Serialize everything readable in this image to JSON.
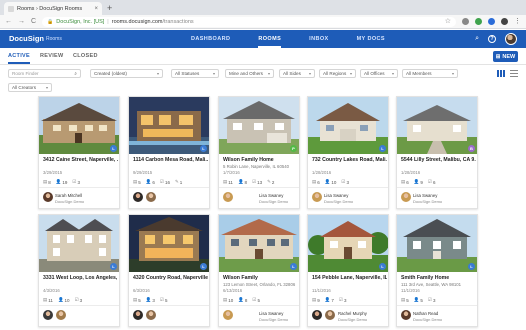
{
  "browser": {
    "tab_title": "Rooms › DocuSign Rooms",
    "tab_close": "×",
    "newtab": "+",
    "back": "←",
    "forward": "→",
    "reload": "C",
    "lock": "🔒",
    "cert": "DocuSign, Inc. [US]",
    "separator": "|",
    "url_host": "rooms.docusign.com",
    "url_path": "/transactions",
    "star": "☆",
    "dots": "⋮"
  },
  "app": {
    "logo": "DocuSign",
    "section": "Rooms",
    "nav": [
      "DASHBOARD",
      "ROOMS",
      "INBOX",
      "MY DOCS"
    ],
    "search_icon": "⌕",
    "help": "?",
    "accent": "#1e5cb8"
  },
  "subtabs": [
    "ACTIVE",
    "REVIEW",
    "CLOSED"
  ],
  "new_button": "NEW",
  "filters": {
    "room_finder_placeholder": "Room Finder",
    "search_glyph": "⌕",
    "caret": "▾",
    "created": "Created (oldest)",
    "statuses": "All Statuses",
    "mine": "Mine and Others",
    "sides": "All Sides",
    "regions": "All Regions",
    "offices": "All Offices",
    "members": "All Members",
    "creators": "All Creators"
  },
  "stat_icons": {
    "docs": "▤",
    "people": "👤",
    "tasks": "☑",
    "edits": "✎"
  },
  "cards": [
    {
      "title": "3412 Caine Street, Naperville, ...",
      "sub": "",
      "date": "3/29/2015",
      "stats": [
        "8",
        "19",
        "3",
        ""
      ],
      "badge": "L",
      "badge_color": "#3a7bd5",
      "agent": "Sarah Mitchell",
      "company": "DocuSign Demo"
    },
    {
      "title": "1114 Carbon Mesa Road, Mali...",
      "sub": "",
      "date": "9/29/2015",
      "stats": [
        "5",
        "6",
        "16",
        "1"
      ],
      "badge": "L",
      "badge_color": "#3a7bd5",
      "agent": "",
      "company": ""
    },
    {
      "title": "Wilson Family Home",
      "sub": "5 Robin Lane, Naperville, IL 60540",
      "date": "1/7/2016",
      "stats": [
        "11",
        "8",
        "13",
        "2"
      ],
      "badge": "P",
      "badge_color": "#54b948",
      "agent": "Lisa Swaney",
      "company": "DocuSign Demo"
    },
    {
      "title": "732 Country Lakes Road, Mali...",
      "sub": "",
      "date": "1/28/2016",
      "stats": [
        "6",
        "10",
        "3",
        ""
      ],
      "badge": "L",
      "badge_color": "#3a7bd5",
      "agent": "Lisa Swaney",
      "company": "DocuSign Demo"
    },
    {
      "title": "5544 Lilly Street, Malibu, CA 9...",
      "sub": "",
      "date": "1/28/2016",
      "stats": [
        "6",
        "9",
        "6",
        ""
      ],
      "badge": "B",
      "badge_color": "#9b6bcc",
      "agent": "Lisa Swaney",
      "company": "DocuSign Demo"
    },
    {
      "title": "3331 West Loop, Los Angeles, ...",
      "sub": "",
      "date": "4/3/2016",
      "stats": [
        "11",
        "10",
        "3",
        ""
      ],
      "badge": "L",
      "badge_color": "#3a7bd5",
      "agent": "",
      "company": ""
    },
    {
      "title": "4320 Country Road, Naperville, ...",
      "sub": "",
      "date": "6/3/2016",
      "stats": [
        "5",
        "3",
        "5",
        ""
      ],
      "badge": "L",
      "badge_color": "#3a7bd5",
      "agent": "",
      "company": ""
    },
    {
      "title": "Wilson Family",
      "sub": "123 Lemon Street, Orlando, FL 32806",
      "date": "6/13/2016",
      "stats": [
        "10",
        "8",
        "5",
        ""
      ],
      "badge": "L",
      "badge_color": "#3a7bd5",
      "agent": "Lisa Swaney",
      "company": "DocuSign Demo"
    },
    {
      "title": "154 Pebble Lane, Naperville, IL...",
      "sub": "",
      "date": "11/1/2016",
      "stats": [
        "9",
        "7",
        "3",
        ""
      ],
      "badge": "L",
      "badge_color": "#3a7bd5",
      "agent": "Rachel Murphy",
      "company": "DocuSign Demo"
    },
    {
      "title": "Smith Family Home",
      "sub": "111 3rd Ave, Seattle, WA 98101",
      "date": "11/1/2016",
      "stats": [
        "5",
        "5",
        "3",
        ""
      ],
      "badge": "L",
      "badge_color": "#3a7bd5",
      "agent": "Nathan Read",
      "company": "DocuSign Demo"
    }
  ]
}
